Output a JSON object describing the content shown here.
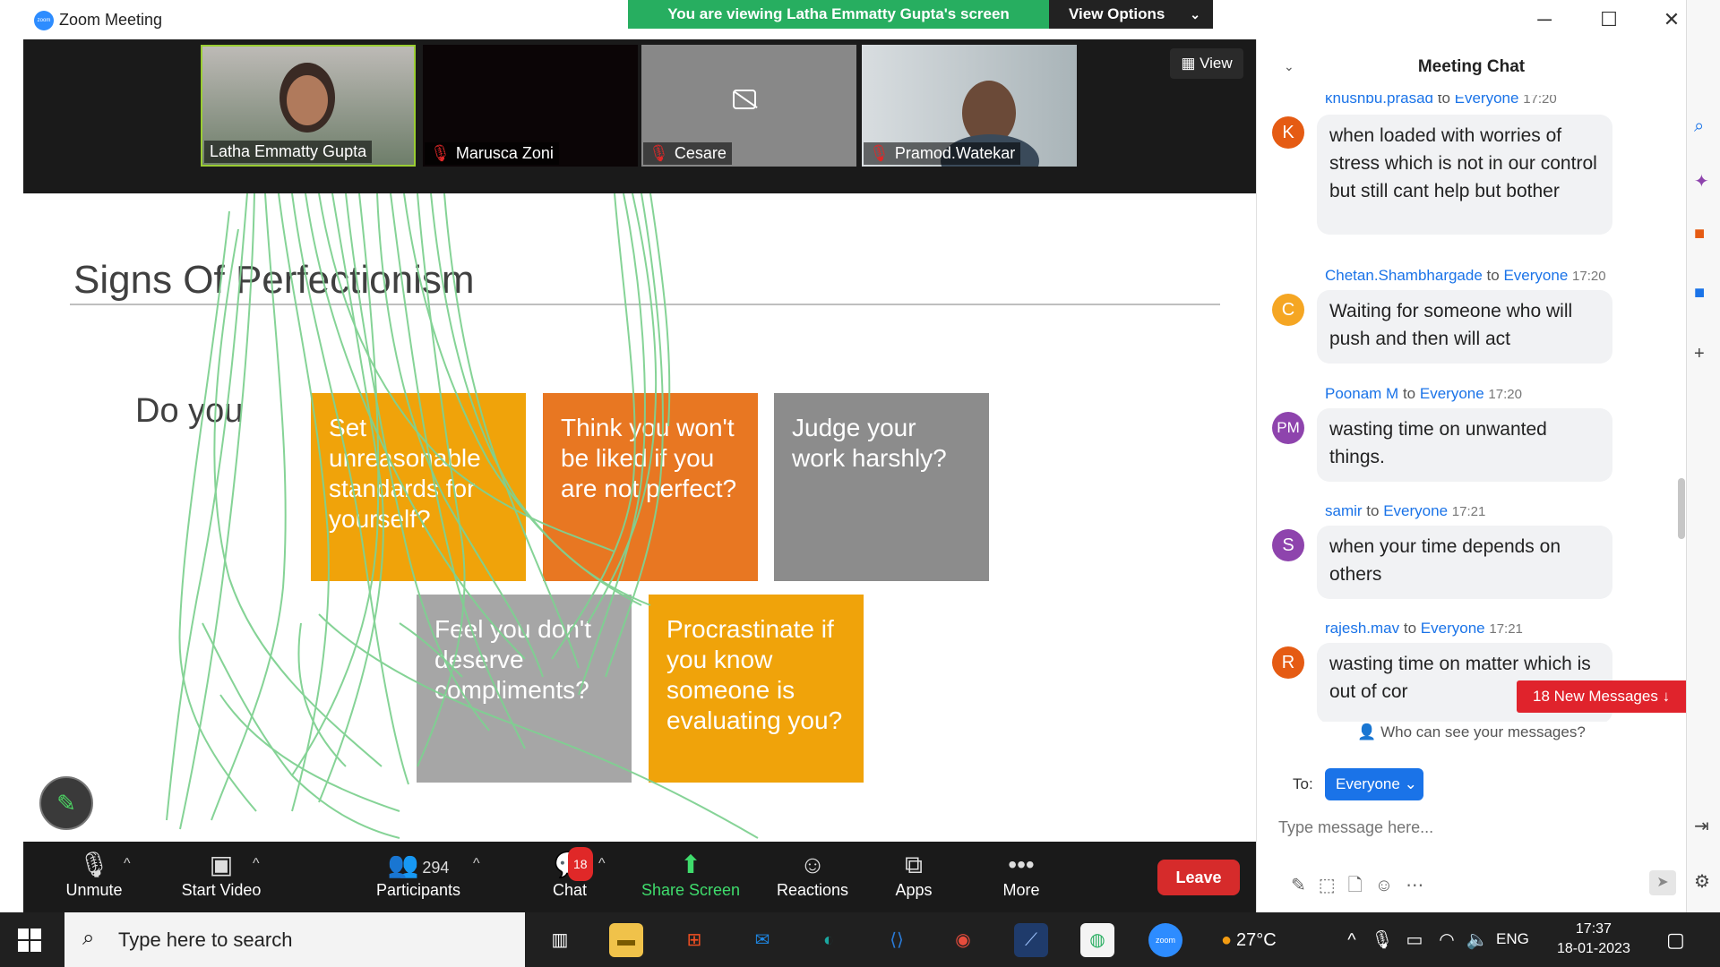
{
  "window": {
    "title": "Zoom Meeting",
    "logo_text": "zoom",
    "banner": "You are viewing Latha Emmatty Gupta's screen",
    "view_options": "View Options",
    "controls": {
      "minimize": "─",
      "maximize": "☐",
      "close": "✕"
    }
  },
  "video": {
    "view_label": "View",
    "participants": [
      {
        "name": "Latha Emmatty Gupta",
        "muted": false
      },
      {
        "name": "Marusca Zoni",
        "muted": true
      },
      {
        "name": "Cesare",
        "muted": true
      },
      {
        "name": "Pramod.Watekar",
        "muted": true
      }
    ]
  },
  "slide": {
    "title": "Signs Of Perfectionism",
    "prompt": "Do you",
    "boxes": [
      {
        "text": "Set unreasonable standards for yourself?",
        "color": "#f0a30a"
      },
      {
        "text": "Think you won't be liked if you are not perfect?",
        "color": "#e87722"
      },
      {
        "text": "Judge your work harshly?",
        "color": "#8c8c8c"
      },
      {
        "text": "Feel you don't deserve compliments?",
        "color": "#a6a6a6"
      },
      {
        "text": "Procrastinate if you know someone is evaluating you?",
        "color": "#f0a30a"
      }
    ],
    "annotation_color": "#7fd191"
  },
  "toolbar": {
    "unmute": "Unmute",
    "start_video": "Start Video",
    "participants": "Participants",
    "participants_count": "294",
    "chat": "Chat",
    "chat_badge": "18",
    "share_screen": "Share Screen",
    "reactions": "Reactions",
    "apps": "Apps",
    "more": "More",
    "leave": "Leave"
  },
  "chat": {
    "header": "Meeting Chat",
    "messages": [
      {
        "sender": "khushbu.prasad",
        "to": "to",
        "recipient": "Everyone",
        "time": "17:20",
        "initials": "K",
        "avatar_color": "#e55b13",
        "text": "when loaded with worries of stress which is not in our control but still cant help but bother"
      },
      {
        "sender": "Chetan.Shambhargade",
        "to": "to",
        "recipient": "Everyone",
        "time": "17:20",
        "initials": "C",
        "avatar_color": "#f5a623",
        "text": "Waiting for someone who will push and then will act"
      },
      {
        "sender": "Poonam M",
        "to": "to",
        "recipient": "Everyone",
        "time": "17:20",
        "initials": "PM",
        "avatar_color": "#8e44ad",
        "text": "wasting  time on unwanted things."
      },
      {
        "sender": "samir",
        "to": "to",
        "recipient": "Everyone",
        "time": "17:21",
        "initials": "S",
        "avatar_color": "#8e44ad",
        "text": "when your time depends on others"
      },
      {
        "sender": "rajesh.mav",
        "to": "to",
        "recipient": "Everyone",
        "time": "17:21",
        "initials": "R",
        "avatar_color": "#e55b13",
        "text": "wasting time on matter which is out of cor"
      }
    ],
    "new_messages": "18 New Messages",
    "who_can_see": "Who can see your messages?",
    "to_label": "To:",
    "to_value": "Everyone",
    "input_placeholder": "Type message here..."
  },
  "taskbar": {
    "search_placeholder": "Type here to search",
    "temperature": "27°C",
    "language": "ENG",
    "time": "17:37",
    "date": "18-01-2023",
    "zoom_app_label": "zoom"
  }
}
